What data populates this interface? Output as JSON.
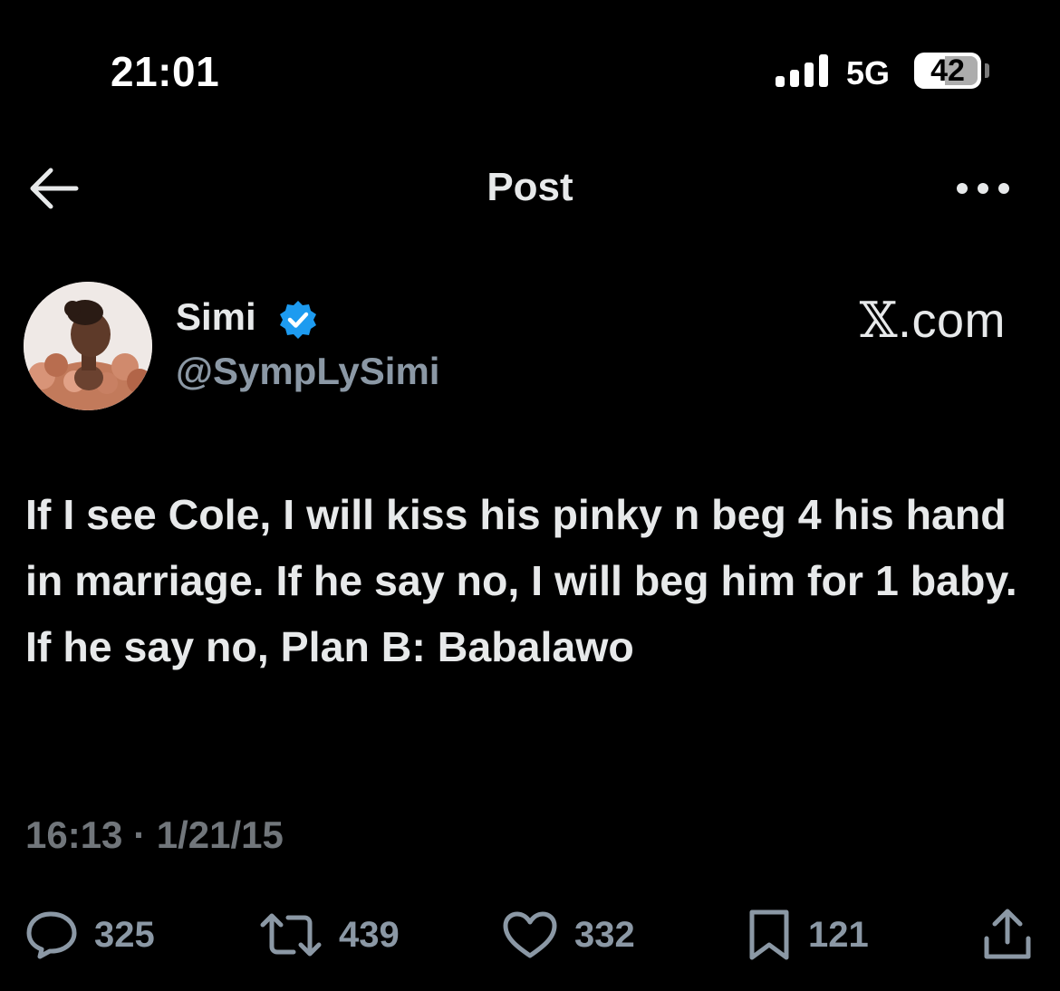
{
  "status_bar": {
    "time": "21:01",
    "network": "5G",
    "battery": "42"
  },
  "header": {
    "title": "Post",
    "back_icon": "arrow-left-icon",
    "more_icon": "more-horizontal-icon"
  },
  "author": {
    "name": "Simi",
    "handle": "@SympLySimi",
    "verified": true,
    "verified_color": "#1d9bf0"
  },
  "source": {
    "brand": "𝕏",
    "suffix": ".com"
  },
  "tweet": {
    "text": "If I see Cole, I will kiss his pinky n beg 4 his hand in marriage. If he say no, I will beg him for 1 baby. If he say no, Plan B: Babalawo",
    "timestamp": "16:13 · 1/21/15"
  },
  "actions": {
    "replies": "325",
    "reposts": "439",
    "likes": "332",
    "bookmarks": "121",
    "share_icon": "share-icon"
  },
  "colors": {
    "background": "#000000",
    "text": "#e7e9ea",
    "muted": "#8b98a5",
    "timestamp": "#71767b"
  }
}
